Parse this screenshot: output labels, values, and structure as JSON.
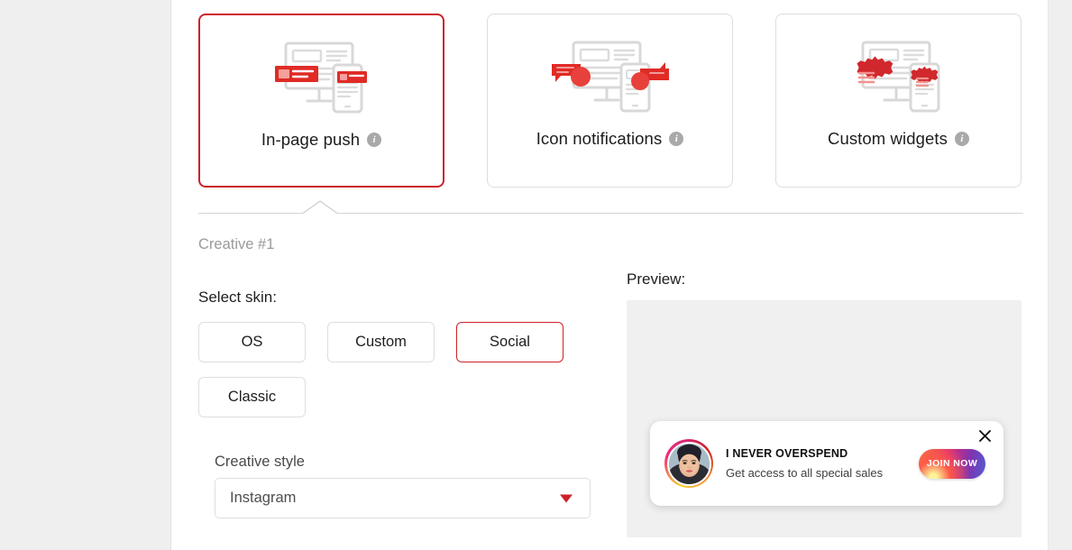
{
  "formats": {
    "cards": [
      {
        "label": "In-page push",
        "art": "monitor-phone-banner-illustration",
        "info_icon": "info-icon",
        "selected": true
      },
      {
        "label": "Icon notifications",
        "art": "monitor-phone-icon-bubble-illustration",
        "info_icon": "info-icon",
        "selected": false
      },
      {
        "label": "Custom widgets",
        "art": "monitor-phone-badge-illustration",
        "info_icon": "info-icon",
        "selected": false
      }
    ]
  },
  "creative": {
    "number_label": "Creative #1",
    "skin_label": "Select skin:",
    "skins": [
      {
        "label": "OS",
        "selected": false
      },
      {
        "label": "Custom",
        "selected": false
      },
      {
        "label": "Social",
        "selected": true
      },
      {
        "label": "Classic",
        "selected": false
      }
    ],
    "style_field": {
      "label": "Creative style",
      "value": "Instagram",
      "arrow_icon": "chevron-down-icon"
    }
  },
  "preview": {
    "label": "Preview:",
    "notification": {
      "title": "I NEVER OVERSPEND",
      "subtitle": "Get access to all special sales",
      "cta_label": "JOIN NOW",
      "close_icon": "close-icon",
      "avatar_icon": "avatar-portrait"
    }
  },
  "colors": {
    "accent_red": "#cc2229",
    "border_gray": "#dededf",
    "muted_text": "#9a9a9a",
    "page_bg": "#efefef",
    "preview_bg": "#f0f0f0"
  }
}
